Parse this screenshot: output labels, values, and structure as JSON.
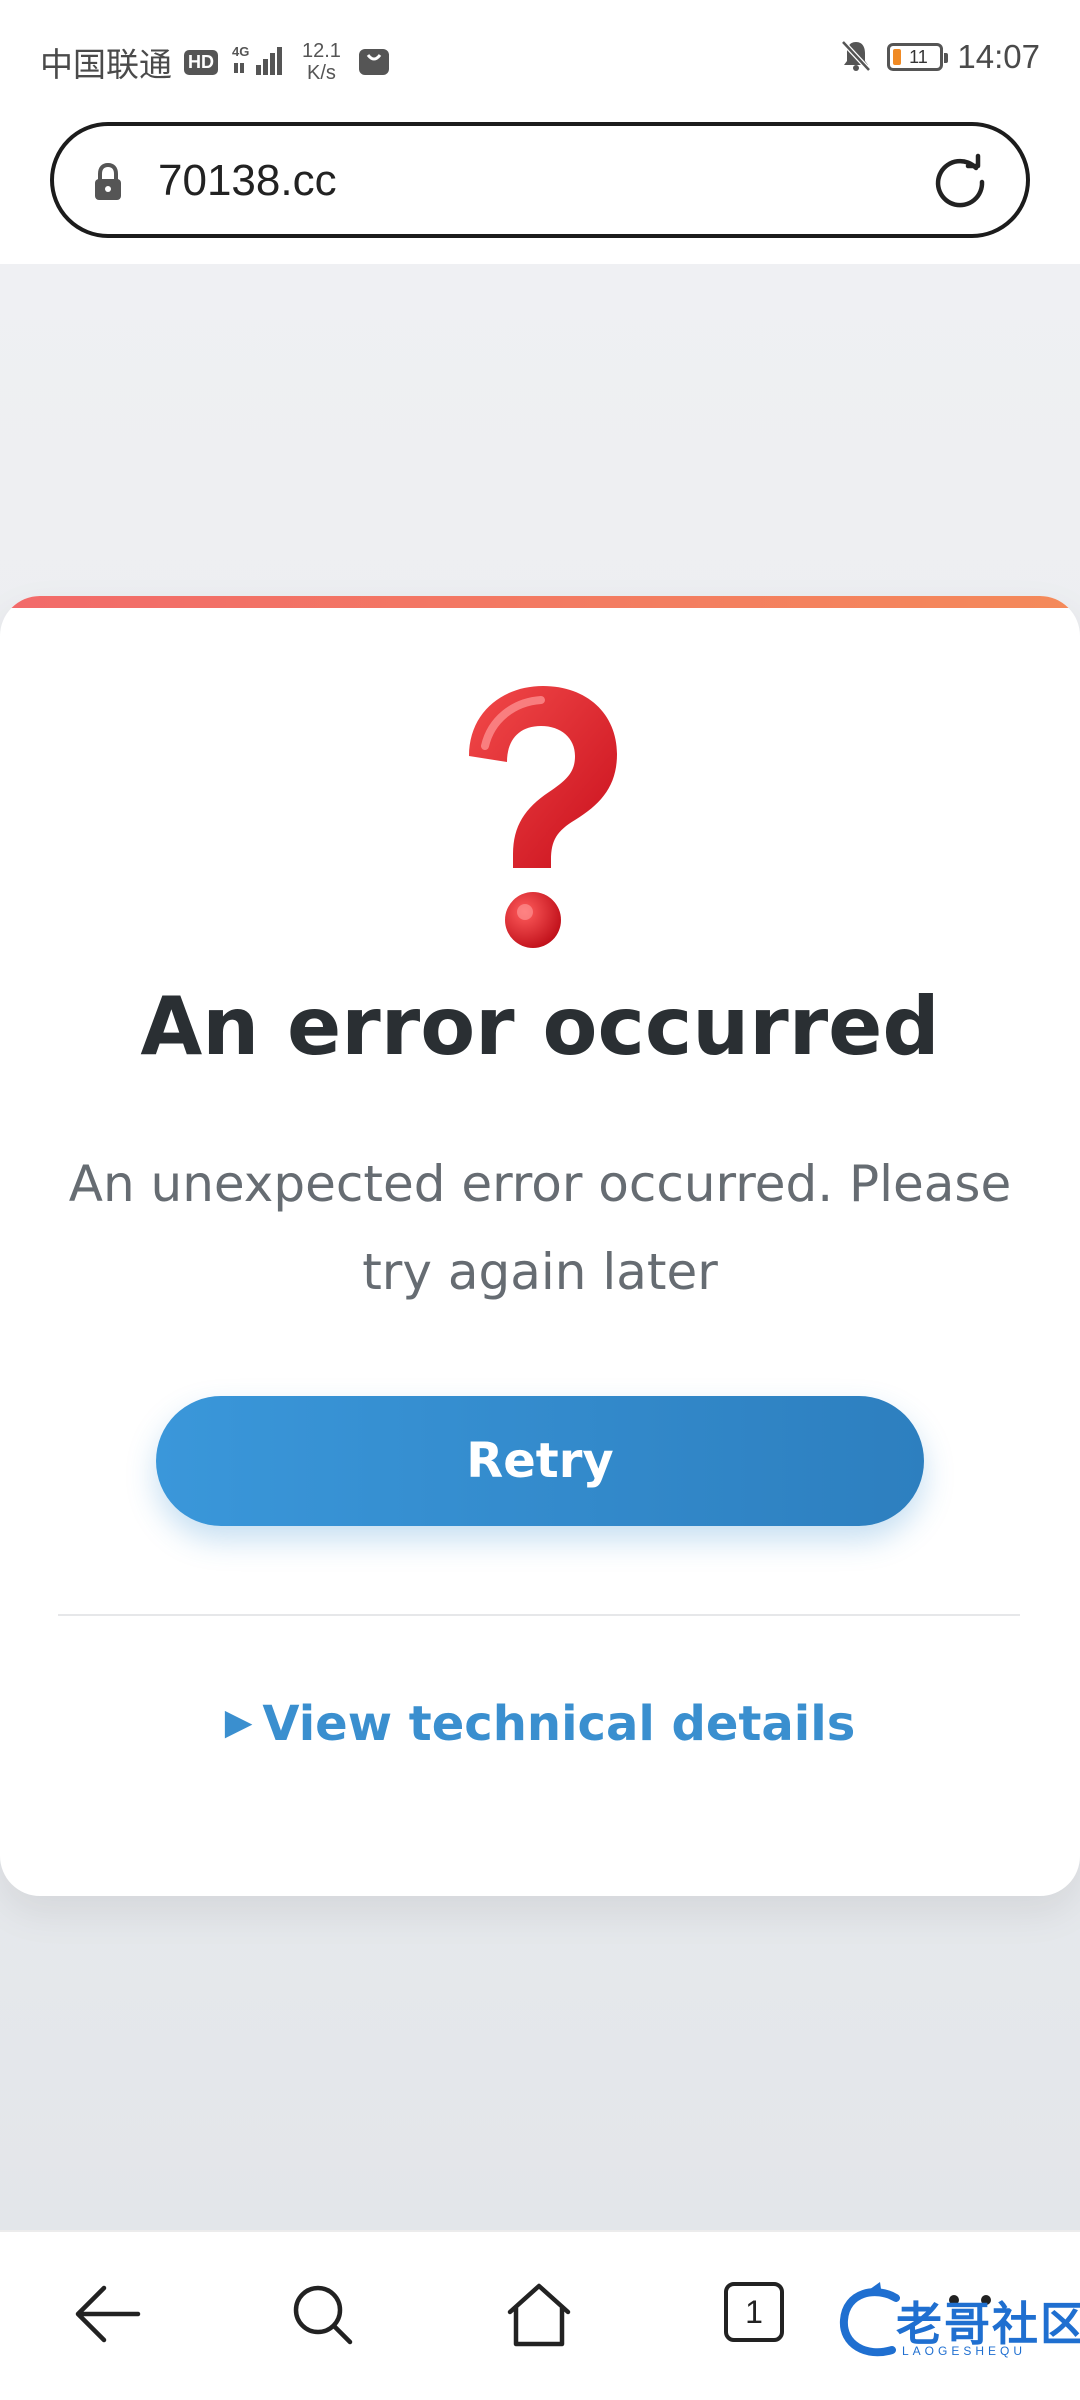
{
  "status_bar": {
    "carrier": "中国联通",
    "hd": "HD",
    "network": "4G",
    "speed_value": "12.1",
    "speed_unit": "K/s",
    "battery_level": "11",
    "time": "14:07"
  },
  "address_bar": {
    "url": "70138.cc"
  },
  "error": {
    "title": "An error occurred",
    "message": "An unexpected error occurred. Please try again later",
    "retry_label": "Retry",
    "details_label": "View technical details",
    "details_marker": "▶"
  },
  "bottom_nav": {
    "tabs_count": "1"
  },
  "watermark": {
    "text": "老哥社区",
    "sub": "LAOGESHEQU"
  },
  "colors": {
    "accent": "#3a8fcf",
    "button_gradient_start": "#3a97da",
    "button_gradient_end": "#2d7fbf",
    "top_bar_gradient_start": "#f26a6a",
    "top_bar_gradient_end": "#f48a5a",
    "title": "#2a2f33",
    "message": "#666c72"
  },
  "icons": {
    "status": [
      "hd-icon",
      "signal-icon",
      "shopping-bag-icon",
      "mute-bell-icon",
      "battery-icon"
    ],
    "address": [
      "lock-icon",
      "reload-icon"
    ],
    "content": [
      "question-mark-icon"
    ],
    "nav": [
      "back-icon",
      "search-icon",
      "home-icon",
      "tabs-icon",
      "menu-icon"
    ]
  }
}
